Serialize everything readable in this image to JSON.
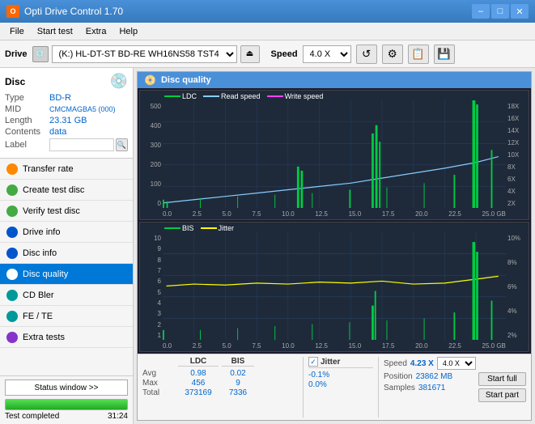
{
  "app": {
    "title": "Opti Drive Control 1.70",
    "icon_label": "O"
  },
  "title_buttons": {
    "minimize": "–",
    "maximize": "□",
    "close": "✕"
  },
  "menu": {
    "items": [
      "File",
      "Start test",
      "Extra",
      "Help"
    ]
  },
  "toolbar": {
    "drive_label": "Drive",
    "drive_name": "(K:)  HL-DT-ST BD-RE  WH16NS58 TST4",
    "speed_label": "Speed",
    "speed_value": "4.0 X"
  },
  "disc": {
    "section_label": "Disc",
    "type_label": "Type",
    "type_value": "BD-R",
    "mid_label": "MID",
    "mid_value": "CMCMAGBA5 (000)",
    "length_label": "Length",
    "length_value": "23.31 GB",
    "contents_label": "Contents",
    "contents_value": "data",
    "label_label": "Label",
    "label_value": ""
  },
  "nav_items": [
    {
      "id": "transfer-rate",
      "label": "Transfer rate",
      "icon": "orange"
    },
    {
      "id": "create-test-disc",
      "label": "Create test disc",
      "icon": "green"
    },
    {
      "id": "verify-test-disc",
      "label": "Verify test disc",
      "icon": "green"
    },
    {
      "id": "drive-info",
      "label": "Drive info",
      "icon": "blue"
    },
    {
      "id": "disc-info",
      "label": "Disc info",
      "icon": "blue"
    },
    {
      "id": "disc-quality",
      "label": "Disc quality",
      "icon": "blue",
      "active": true
    },
    {
      "id": "cd-bler",
      "label": "CD Bler",
      "icon": "teal"
    },
    {
      "id": "fe-te",
      "label": "FE / TE",
      "icon": "teal"
    },
    {
      "id": "extra-tests",
      "label": "Extra tests",
      "icon": "purple"
    }
  ],
  "status": {
    "window_btn": "Status window >>",
    "progress_pct": 100,
    "status_text": "Test completed",
    "time_text": "31:24"
  },
  "disc_quality": {
    "title": "Disc quality",
    "chart1": {
      "legend": [
        {
          "label": "LDC",
          "color": "#00cc44"
        },
        {
          "label": "Read speed",
          "color": "#88ccff"
        },
        {
          "label": "Write speed",
          "color": "#ff44ff"
        }
      ],
      "y_left": [
        "500",
        "400",
        "300",
        "200",
        "100",
        "0"
      ],
      "y_right": [
        "18X",
        "16X",
        "14X",
        "12X",
        "10X",
        "8X",
        "6X",
        "4X",
        "2X"
      ],
      "x_axis": [
        "0.0",
        "2.5",
        "5.0",
        "7.5",
        "10.0",
        "12.5",
        "15.0",
        "17.5",
        "20.0",
        "22.5",
        "25.0 GB"
      ]
    },
    "chart2": {
      "legend": [
        {
          "label": "BIS",
          "color": "#00cc44"
        },
        {
          "label": "Jitter",
          "color": "#ffff00"
        }
      ],
      "y_left": [
        "10",
        "9",
        "8",
        "7",
        "6",
        "5",
        "4",
        "3",
        "2",
        "1"
      ],
      "y_right": [
        "10%",
        "8%",
        "6%",
        "4%",
        "2%"
      ],
      "x_axis": [
        "0.0",
        "2.5",
        "5.0",
        "7.5",
        "10.0",
        "12.5",
        "15.0",
        "17.5",
        "20.0",
        "22.5",
        "25.0 GB"
      ]
    }
  },
  "stats": {
    "headers": [
      "",
      "LDC",
      "BIS",
      "",
      "Jitter"
    ],
    "avg_label": "Avg",
    "avg_ldc": "0.98",
    "avg_bis": "0.02",
    "avg_jitter": "-0.1%",
    "max_label": "Max",
    "max_ldc": "456",
    "max_bis": "9",
    "max_jitter": "0.0%",
    "total_label": "Total",
    "total_ldc": "373169",
    "total_bis": "7336",
    "jitter_checked": true,
    "speed_label": "Speed",
    "speed_value": "4.23 X",
    "speed_select": "4.0 X",
    "position_label": "Position",
    "position_value": "23862 MB",
    "samples_label": "Samples",
    "samples_value": "381671",
    "start_full_label": "Start full",
    "start_part_label": "Start part"
  }
}
